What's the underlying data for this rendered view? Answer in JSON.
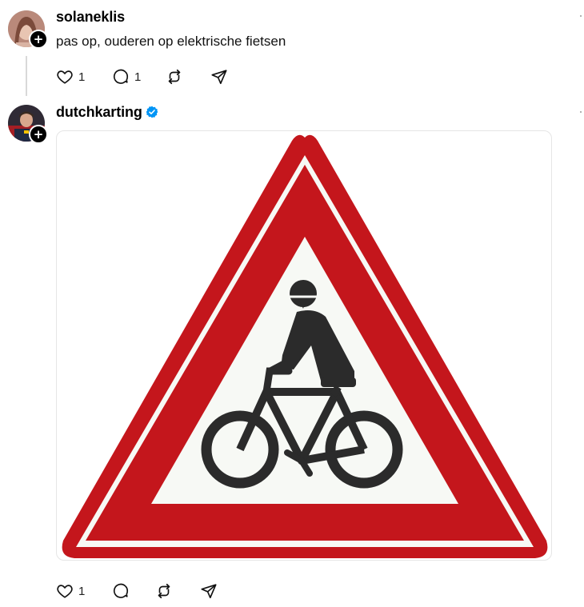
{
  "posts": [
    {
      "username": "solaneklis",
      "text": "pas op, ouderen op elektrische fietsen",
      "likes": "1",
      "replies": "1"
    },
    {
      "username": "dutchkarting",
      "verified": true,
      "likes": "1",
      "image_alt": "Traffic warning sign: cyclists"
    }
  ],
  "icons": {
    "like": "heart-icon",
    "reply": "comment-icon",
    "repost": "repost-icon",
    "share": "send-icon",
    "follow": "plus-icon",
    "verified": "verified-badge-icon"
  },
  "colors": {
    "sign_red": "#c4161c",
    "verified_blue": "#0095f6",
    "sign_black": "#2b2b2b"
  }
}
